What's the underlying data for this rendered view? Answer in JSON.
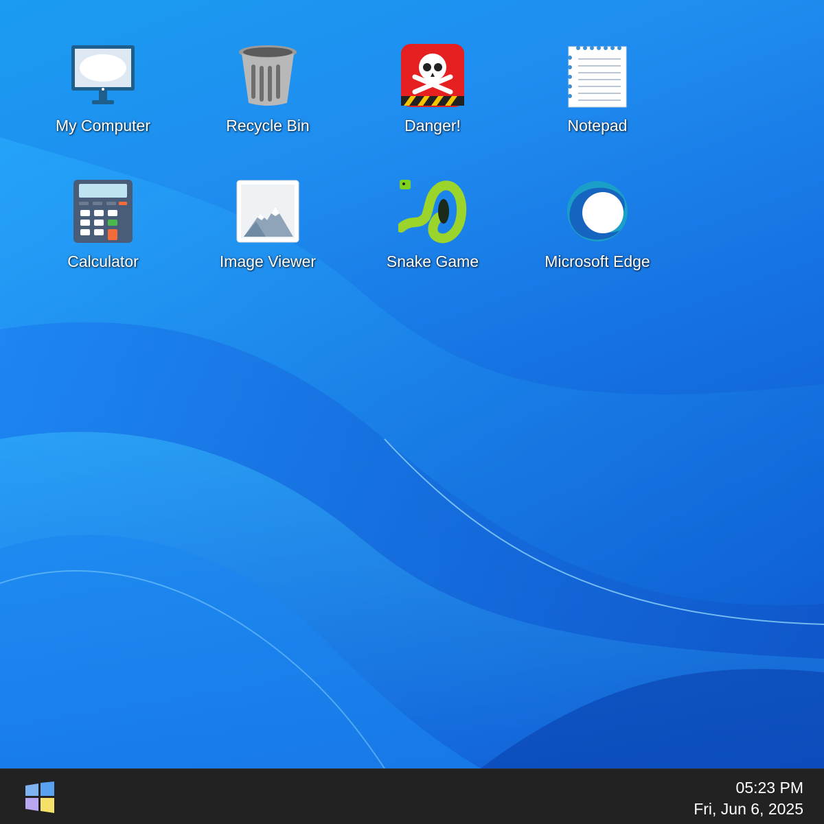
{
  "desktop": {
    "icons": [
      {
        "label": "My Computer",
        "icon": "computer-monitor-icon"
      },
      {
        "label": "Recycle Bin",
        "icon": "trash-can-icon"
      },
      {
        "label": "Danger!",
        "icon": "skull-crossbones-icon"
      },
      {
        "label": "Notepad",
        "icon": "notepad-icon"
      },
      {
        "label": "Calculator",
        "icon": "calculator-icon"
      },
      {
        "label": "Image Viewer",
        "icon": "image-mountain-icon"
      },
      {
        "label": "Snake Game",
        "icon": "snake-icon"
      },
      {
        "label": "Microsoft Edge",
        "icon": "edge-browser-icon"
      }
    ]
  },
  "taskbar": {
    "start_icon": "windows-logo-icon",
    "time": "05:23 PM",
    "date": "Fri, Jun 6, 2025"
  },
  "colors": {
    "wallpaper_blue": "#1f8df0",
    "taskbar_bg": "#222222",
    "danger_red": "#e62020"
  }
}
